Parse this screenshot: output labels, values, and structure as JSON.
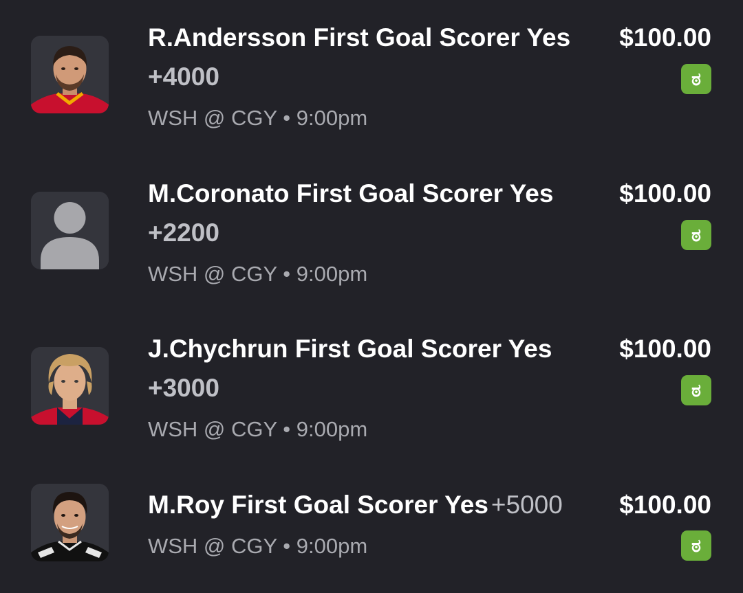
{
  "bets": [
    {
      "title": "R.Andersson First Goal Scorer Yes",
      "odds": "+4000",
      "matchup": "WSH @ CGY",
      "separator": "•",
      "time": "9:00pm",
      "amount": "$100.00",
      "avatar": "player-photo",
      "sportsbook_icon": "draftkings-icon"
    },
    {
      "title": "M.Coronato First Goal Scorer Yes",
      "odds": "+2200",
      "matchup": "WSH @ CGY",
      "separator": "•",
      "time": "9:00pm",
      "amount": "$100.00",
      "avatar": "placeholder-person-icon",
      "sportsbook_icon": "draftkings-icon"
    },
    {
      "title": "J.Chychrun First Goal Scorer Yes",
      "odds": "+3000",
      "matchup": "WSH @ CGY",
      "separator": "•",
      "time": "9:00pm",
      "amount": "$100.00",
      "avatar": "player-photo",
      "sportsbook_icon": "draftkings-icon"
    },
    {
      "title": "M.Roy First Goal Scorer Yes",
      "odds": "+5000",
      "matchup": "WSH @ CGY",
      "separator": "•",
      "time": "9:00pm",
      "amount": "$100.00",
      "avatar": "player-photo",
      "sportsbook_icon": "draftkings-icon"
    }
  ],
  "colors": {
    "background": "#222228",
    "card": "#34353c",
    "badge": "#6aae3a"
  }
}
